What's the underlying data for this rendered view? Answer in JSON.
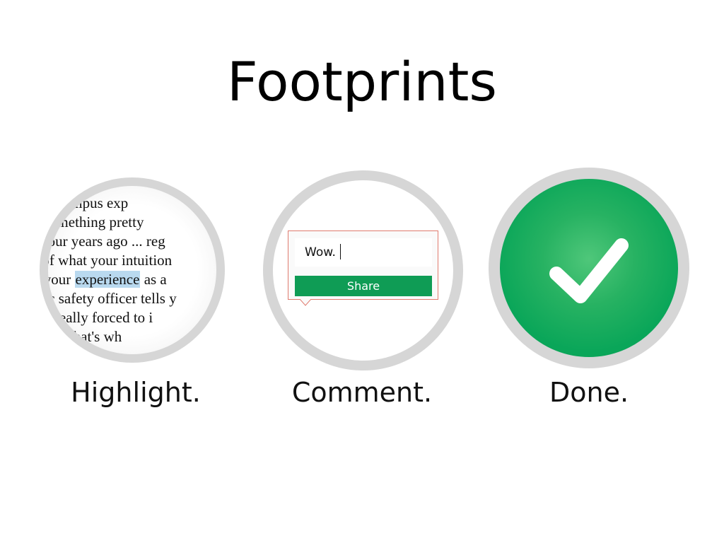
{
  "app": {
    "title": "Footprints"
  },
  "steps": [
    {
      "label": "Highlight.",
      "icon": "magnifier-text-icon",
      "book_lines": [
        "  this campus exp",
        "d something pretty",
        "e four years ago ... reg",
        "s of what your intuition",
        "d your ",
        "blic safety officer tells y",
        "are really forced to i",
        "t, and that's wh"
      ],
      "highlighted_word": "experience",
      "line5_after": " as a"
    },
    {
      "label": "Comment.",
      "comment_text": "Wow.",
      "share_label": "Share"
    },
    {
      "label": "Done.",
      "icon": "checkmark-icon"
    }
  ],
  "colors": {
    "accent_green": "#0f9c55",
    "ring_gray": "#d6d6d6",
    "highlight_blue": "#b9d9ef",
    "callout_border": "#e07b6f"
  }
}
